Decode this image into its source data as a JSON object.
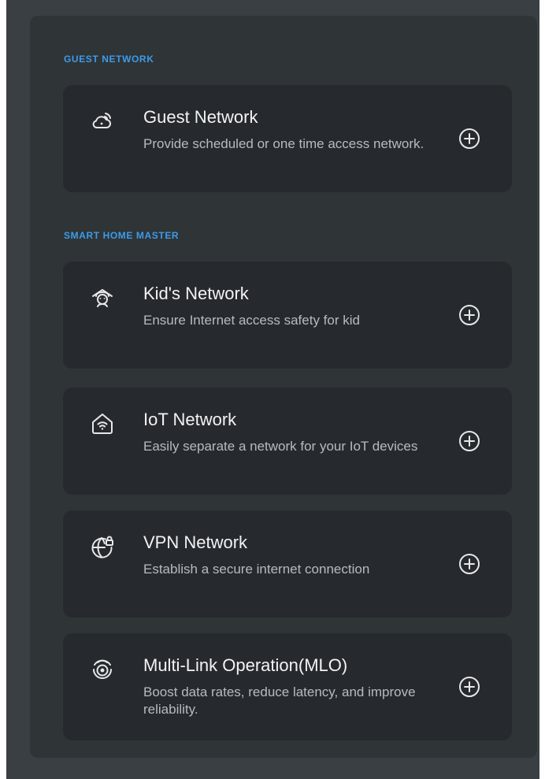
{
  "sections": [
    {
      "title": "GUEST NETWORK",
      "items": [
        {
          "icon": "cloud-wifi-icon",
          "title": "Guest Network",
          "desc": "Provide scheduled or one time access network."
        }
      ]
    },
    {
      "title": "SMART HOME MASTER",
      "items": [
        {
          "icon": "kid-face-icon",
          "title": "Kid's Network",
          "desc": "Ensure Internet access safety for kid"
        },
        {
          "icon": "home-wifi-icon",
          "title": "IoT Network",
          "desc": "Easily separate a network for your IoT devices"
        },
        {
          "icon": "globe-lock-icon",
          "title": "VPN Network",
          "desc": "Establish a secure internet connection"
        },
        {
          "icon": "signal-rings-icon",
          "title": "Multi-Link Operation(MLO)",
          "desc": "Boost data rates, reduce latency, and improve reliability."
        }
      ]
    }
  ],
  "colors": {
    "accent": "#3d9be9",
    "panel": "#2f3437",
    "card": "#262a2e",
    "frame": "#3a3f43"
  }
}
